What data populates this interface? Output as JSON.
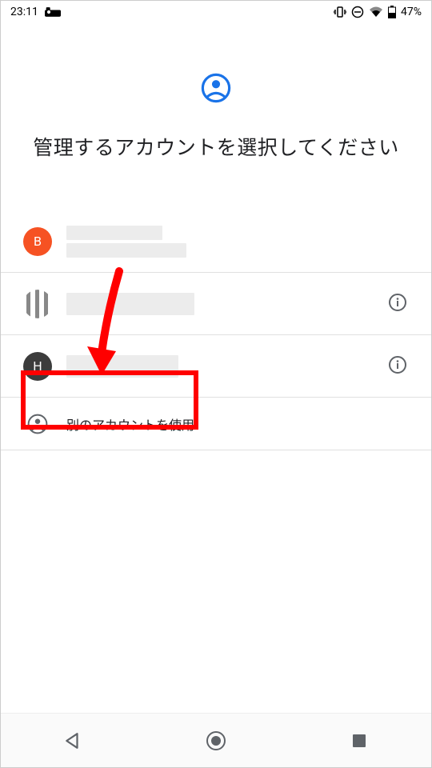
{
  "status": {
    "time": "23:11",
    "battery_pct": "47%"
  },
  "header": {
    "title": "管理するアカウントを選択してください"
  },
  "accounts": [
    {
      "avatar_letter": "B",
      "avatar_color": "#f65223",
      "has_info": false
    },
    {
      "avatar_letter": "",
      "avatar_color": "stripes",
      "has_info": true
    },
    {
      "avatar_letter": "H",
      "avatar_color": "#3c3c3c",
      "has_info": true
    }
  ],
  "use_another_label": "別のアカウントを使用"
}
